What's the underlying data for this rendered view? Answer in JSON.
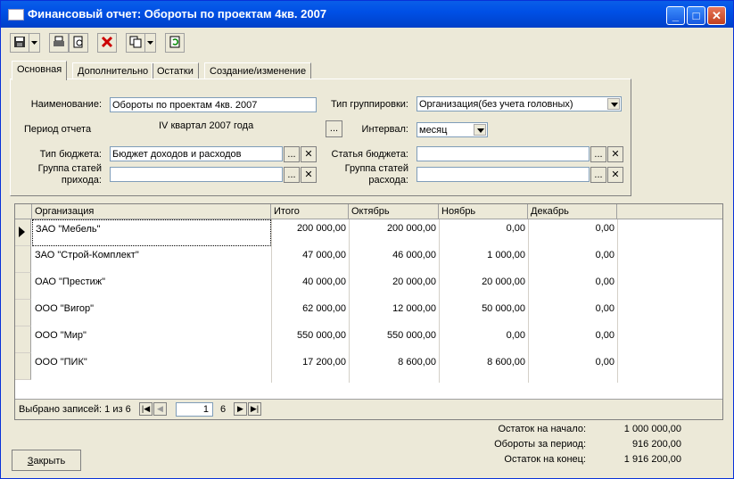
{
  "window": {
    "title": "Финансовый отчет: Обороты по проектам 4кв. 2007"
  },
  "tabs": [
    "Основная",
    "Дополнительно",
    "Остатки",
    "Создание/изменение"
  ],
  "form": {
    "name_label": "Наименование:",
    "name_value": "Обороты по проектам 4кв. 2007",
    "period_label": "Период отчета",
    "period_value": "IV квартал 2007 года",
    "group_type_label": "Тип группировки:",
    "group_type_value": "Организация(без учета головных)",
    "interval_label": "Интервал:",
    "interval_value": "месяц",
    "budget_type_label": "Тип бюджета:",
    "budget_type_value": "Бюджет доходов и расходов",
    "budget_item_label": "Статья бюджета:",
    "budget_item_value": "",
    "income_group_label_1": "Группа статей",
    "income_group_label_2": "прихода:",
    "income_group_value": "",
    "expense_group_label_1": "Группа статей",
    "expense_group_label_2": "расхода:",
    "expense_group_value": ""
  },
  "table": {
    "columns": [
      "Организация",
      "Итого",
      "Октябрь",
      "Ноябрь",
      "Декабрь"
    ],
    "rows": [
      [
        "ЗАО \"Мебель\"",
        "200 000,00",
        "200 000,00",
        "0,00",
        "0,00"
      ],
      [
        "ЗАО \"Строй-Комплект\"",
        "47 000,00",
        "46 000,00",
        "1 000,00",
        "0,00"
      ],
      [
        "ОАО \"Престиж\"",
        "40 000,00",
        "20 000,00",
        "20 000,00",
        "0,00"
      ],
      [
        "ООО \"Вигор\"",
        "62 000,00",
        "12 000,00",
        "50 000,00",
        "0,00"
      ],
      [
        "ООО \"Мир\"",
        "550 000,00",
        "550 000,00",
        "0,00",
        "0,00"
      ],
      [
        "ООО \"ПИК\"",
        "17 200,00",
        "8 600,00",
        "8 600,00",
        "0,00"
      ]
    ]
  },
  "nav": {
    "status": "Выбрано записей: 1 из 6",
    "current": "1",
    "total": "6"
  },
  "totals": {
    "start_label": "Остаток на начало:",
    "start_value": "1 000 000,00",
    "turnover_label": "Обороты за период:",
    "turnover_value": "916 200,00",
    "end_label": "Остаток на конец:",
    "end_value": "1 916 200,00"
  },
  "close_button": "Закрыть",
  "icons": [
    "save-icon",
    "print-icon",
    "preview-icon",
    "delete-icon",
    "copy-icon",
    "refresh-icon"
  ]
}
